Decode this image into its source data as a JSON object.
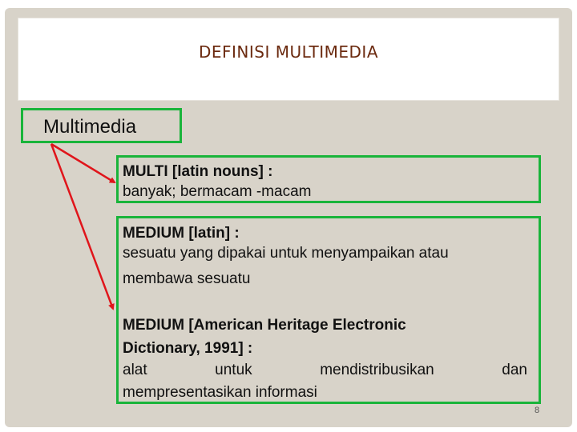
{
  "slide": {
    "title": "DEFINISI MULTIMEDIA",
    "term": "Multimedia",
    "definitions": [
      {
        "heading": "MULTI [latin nouns] :",
        "text": "banyak; bermacam -macam"
      },
      {
        "heading": "MEDIUM [latin] :",
        "text_lines": [
          "sesuatu yang dipakai untuk menyampaikan atau",
          "membawa sesuatu"
        ]
      },
      {
        "heading_lines": [
          "MEDIUM [American Heritage Electronic",
          "Dictionary, 1991] :"
        ],
        "text_line1_words": [
          "alat",
          "untuk",
          "mendistribusikan",
          "dan"
        ],
        "text_line2": "mempresentasikan informasi"
      }
    ],
    "page_number": "8",
    "colors": {
      "background": "#d8d3c9",
      "box_border": "#19b43a",
      "arrow": "#e0151b",
      "title": "#6b2a0f"
    }
  }
}
